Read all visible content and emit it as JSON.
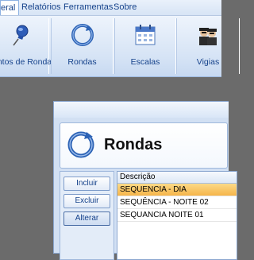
{
  "menu": {
    "items": [
      {
        "label": "eral"
      },
      {
        "label": "Relatórios"
      },
      {
        "label": "Ferramentas"
      },
      {
        "label": "Sobre"
      }
    ]
  },
  "ribbon": {
    "buttons": [
      {
        "label": "ontos de Ronda",
        "icon": "pushpin-icon"
      },
      {
        "label": "Rondas",
        "icon": "refresh-circle-icon"
      },
      {
        "label": "Escalas",
        "icon": "calendar-icon"
      },
      {
        "label": "Vigias",
        "icon": "guards-icon"
      }
    ]
  },
  "form": {
    "title": "Rondas",
    "actions": {
      "include": "Incluir",
      "delete": "Excluir",
      "edit": "Alterar"
    },
    "grid": {
      "column": "Descrição",
      "rows": [
        "SEQUENCIA - DIA",
        "SEQUÊNCIA - NOITE 02",
        "SEQUANCIA NOITE 01"
      ]
    }
  },
  "colors": {
    "accent": "#15428b",
    "selection": "#f6b54a",
    "workspace": "#6b6b6b"
  }
}
